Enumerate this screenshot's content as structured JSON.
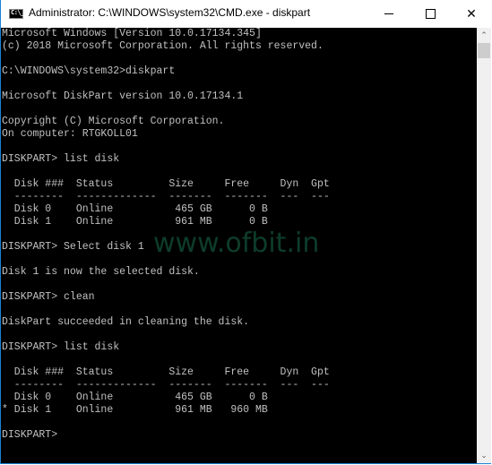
{
  "window": {
    "title": "Administrator: C:\\WINDOWS\\system32\\CMD.exe - diskpart",
    "icon_label": "C:\\_",
    "controls": {
      "minimize": "minimize-icon",
      "maximize": "maximize-icon",
      "close": "close-icon",
      "close_glyph": "✕"
    }
  },
  "console": {
    "lines": [
      "Microsoft Windows [Version 10.0.17134.345]",
      "(c) 2018 Microsoft Corporation. All rights reserved.",
      "",
      "C:\\WINDOWS\\system32>diskpart",
      "",
      "Microsoft DiskPart version 10.0.17134.1",
      "",
      "Copyright (C) Microsoft Corporation.",
      "On computer: RTGKOLL01",
      "",
      "DISKPART> list disk",
      "",
      "  Disk ###  Status         Size     Free     Dyn  Gpt",
      "  --------  -------------  -------  -------  ---  ---",
      "  Disk 0    Online          465 GB      0 B",
      "  Disk 1    Online          961 MB      0 B",
      "",
      "DISKPART> Select disk 1",
      "",
      "Disk 1 is now the selected disk.",
      "",
      "DISKPART> clean",
      "",
      "DiskPart succeeded in cleaning the disk.",
      "",
      "DISKPART> list disk",
      "",
      "  Disk ###  Status         Size     Free     Dyn  Gpt",
      "  --------  -------------  -------  -------  ---  ---",
      "  Disk 0    Online          465 GB      0 B",
      "* Disk 1    Online          961 MB   960 MB",
      "",
      "DISKPART> "
    ],
    "disk_tables": [
      {
        "columns": [
          "Disk ###",
          "Status",
          "Size",
          "Free",
          "Dyn",
          "Gpt"
        ],
        "rows": [
          {
            "selected": false,
            "disk": "Disk 0",
            "status": "Online",
            "size": "465 GB",
            "free": "0 B",
            "dyn": "",
            "gpt": ""
          },
          {
            "selected": false,
            "disk": "Disk 1",
            "status": "Online",
            "size": "961 MB",
            "free": "0 B",
            "dyn": "",
            "gpt": ""
          }
        ]
      },
      {
        "columns": [
          "Disk ###",
          "Status",
          "Size",
          "Free",
          "Dyn",
          "Gpt"
        ],
        "rows": [
          {
            "selected": false,
            "disk": "Disk 0",
            "status": "Online",
            "size": "465 GB",
            "free": "0 B",
            "dyn": "",
            "gpt": ""
          },
          {
            "selected": true,
            "disk": "Disk 1",
            "status": "Online",
            "size": "961 MB",
            "free": "960 MB",
            "dyn": "",
            "gpt": ""
          }
        ]
      }
    ]
  },
  "watermark": "www.ofbit.in",
  "scrollbar": {
    "up_glyph": "⌃",
    "down_glyph": "⌄",
    "position_fraction": 0.0
  },
  "colors": {
    "console_bg": "#000000",
    "console_fg": "#c0c0c0",
    "accent_border": "#1883d7",
    "watermark": "#0d3d2a"
  }
}
